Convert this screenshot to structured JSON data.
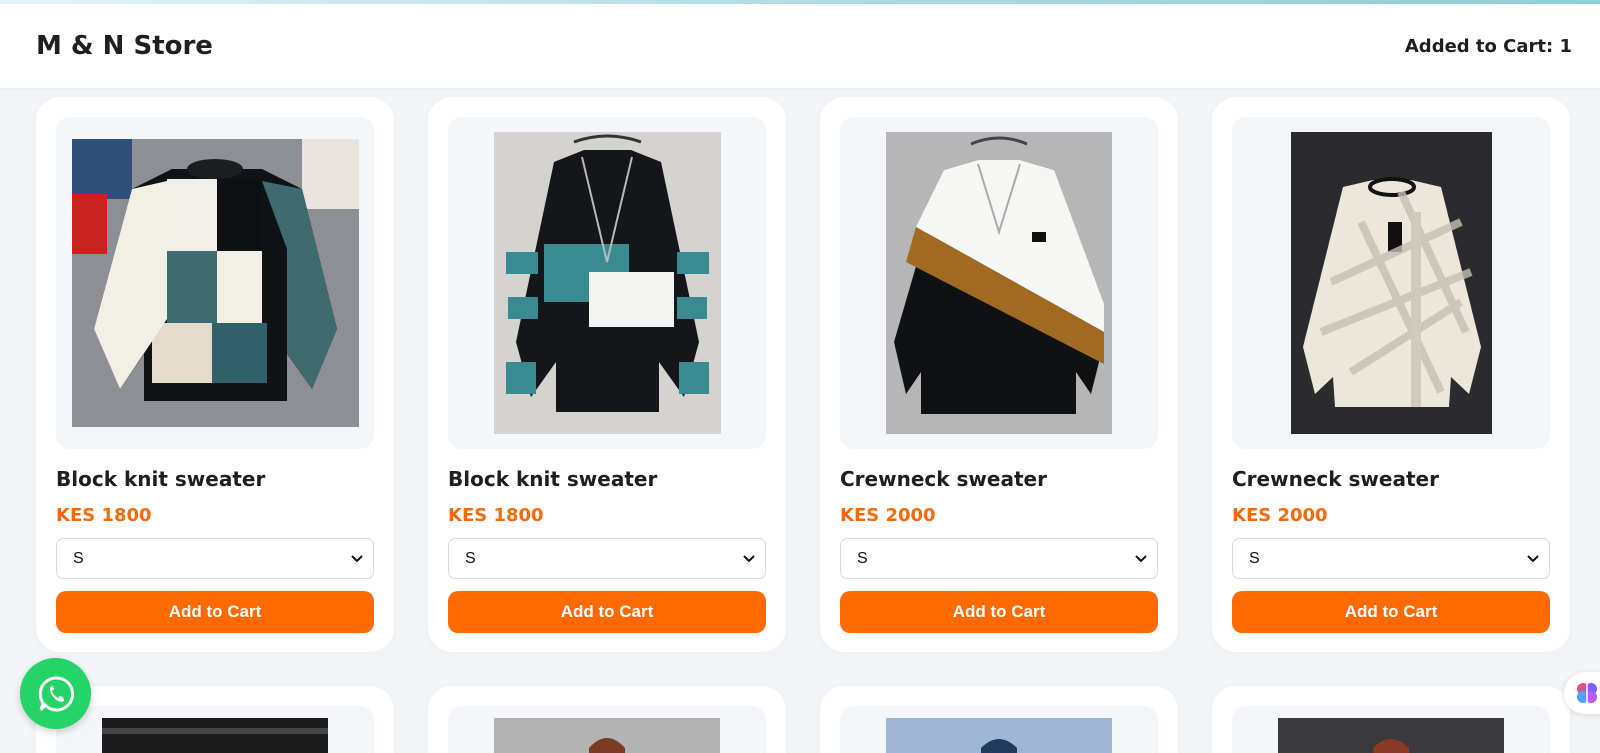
{
  "header": {
    "store_name": "M & N Store",
    "cart_label": "Added to Cart: 1"
  },
  "products": [
    {
      "title": "Block knit sweater",
      "price": "KES 1800",
      "size": "S",
      "button": "Add to Cart",
      "image": "block-knit-sweater-patchwork"
    },
    {
      "title": "Block knit sweater",
      "price": "KES 1800",
      "size": "S",
      "button": "Add to Cart",
      "image": "block-knit-sweater-teal-stripes"
    },
    {
      "title": "Crewneck sweater",
      "price": "KES 2000",
      "size": "S",
      "button": "Add to Cart",
      "image": "crewneck-sweater-diagonal-colorblock"
    },
    {
      "title": "Crewneck sweater",
      "price": "KES 2000",
      "size": "S",
      "button": "Add to Cart",
      "image": "crewneck-sweater-cream-plaid"
    }
  ],
  "floating": {
    "whatsapp_icon": "whatsapp-icon",
    "assistant_icon": "brain-icon"
  },
  "colors": {
    "accent": "#ff6a00",
    "price": "#f26a0c",
    "whatsapp": "#25d366",
    "background": "#f3f5f9"
  }
}
